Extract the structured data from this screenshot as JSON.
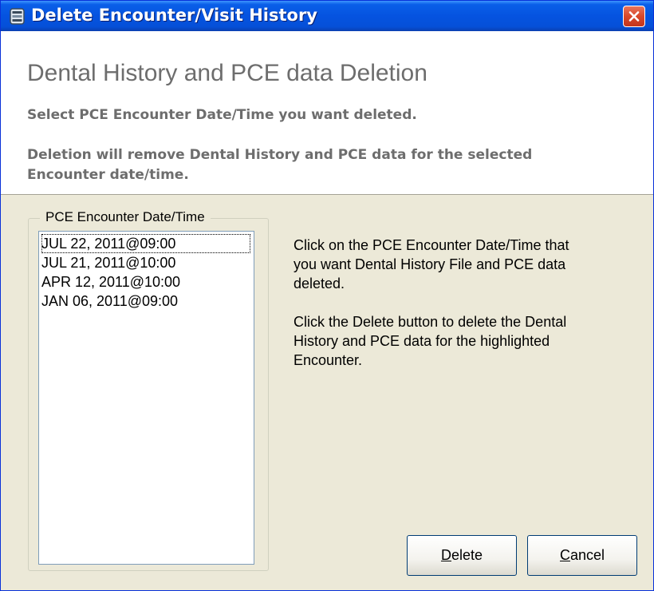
{
  "window": {
    "title": "Delete Encounter/Visit History",
    "title_color": "#ffffff",
    "titlebar_color": "#0553e0",
    "close_button_color": "#d9482a",
    "app_icon": "app-icon",
    "close_icon": "close-x-icon"
  },
  "header": {
    "heading": "Dental History and PCE data Deletion",
    "select_instruction": "Select PCE Encounter Date/Time you want deleted.",
    "deletion_note_line1": "Deletion will remove Dental History and PCE data for the selected",
    "deletion_note_line2": "Encounter date/time."
  },
  "group": {
    "label": "PCE Encounter Date/Time",
    "items": [
      "JUL 22, 2011@09:00",
      "JUL 21, 2011@10:00",
      "APR 12, 2011@10:00",
      "JAN 06, 2011@09:00"
    ]
  },
  "help": {
    "p1_line1": "Click on the PCE Encounter Date/Time that",
    "p1_line2": "you want Dental History File and PCE data",
    "p1_line3": "deleted.",
    "p2_line1": "Click the Delete button to delete the Dental",
    "p2_line2": "History and PCE data for the highlighted",
    "p2_line3": "Encounter."
  },
  "buttons": {
    "delete_mnemonic": "D",
    "delete_rest": "elete",
    "cancel_mnemonic": "C",
    "cancel_rest": "ancel"
  }
}
